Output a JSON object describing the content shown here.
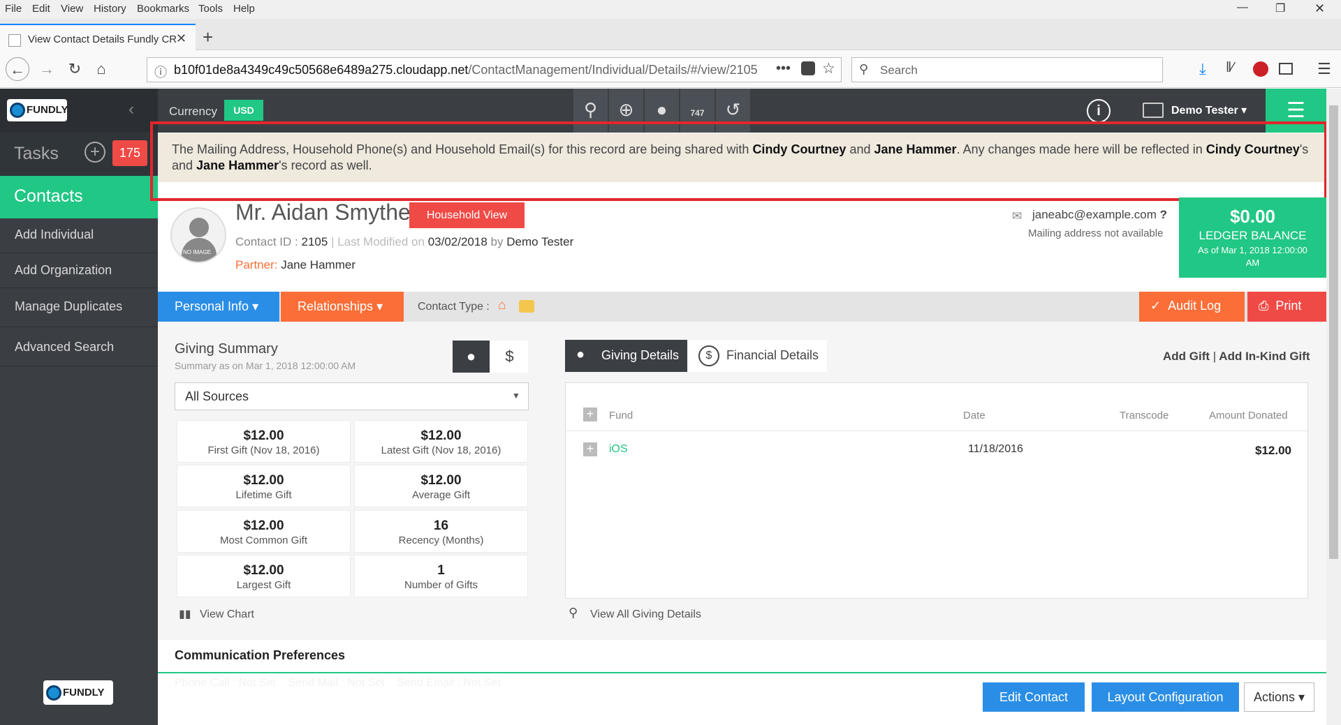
{
  "menubar": {
    "items": [
      "File",
      "Edit",
      "View",
      "History",
      "Bookmarks",
      "Tools",
      "Help"
    ]
  },
  "browser": {
    "tab_title": "View Contact Details Fundly CR",
    "url_domain": "b10f01de8a4349c49c50568e6489a275.cloudapp.net",
    "url_path": "/ContactManagement/Individual/Details/#/view/2105",
    "search_placeholder": "Search"
  },
  "sidebar": {
    "logo": "FUNDLY",
    "tasks_label": "Tasks",
    "tasks_count": "175",
    "contacts_label": "Contacts",
    "items": [
      "Add Individual",
      "Add Organization",
      "Manage Duplicates",
      "Advanced Search"
    ],
    "footer_logo": "FUNDLY"
  },
  "topbar": {
    "currency_label": "Currency",
    "currency_value": "USD",
    "user_name": "Demo Tester",
    "icon_badge": "747"
  },
  "banner": {
    "text1": "The Mailing Address, Household Phone(s) and Household Email(s) for this record are being shared with ",
    "name1": "Cindy Courtney",
    "and": " and ",
    "name2": "Jane Hammer",
    "text2": ". Any changes made here will be reflected in ",
    "name3": "Cindy Courtney",
    "text3": "'s and ",
    "name4": "Jane Hammer",
    "text4": "'s record as well."
  },
  "contact": {
    "name": "Mr. Aidan Smythe",
    "household_button": "Household View",
    "avatar_text": "NO IMAGE",
    "contact_id_label": "Contact ID :",
    "contact_id": "2105",
    "last_modified_label": "| Last Modified on",
    "last_modified_date": "03/02/2018",
    "by_label": "by",
    "modified_by": "Demo Tester",
    "partner_label": "Partner:",
    "partner_name": "Jane Hammer",
    "email": "janeabc@example.com",
    "email_q": "?",
    "mailing_address": "Mailing address not available"
  },
  "ledger": {
    "amount": "$0.00",
    "label": "LEDGER BALANCE",
    "as_of": "As of Mar 1, 2018 12:00:00 AM"
  },
  "tabs": {
    "personal_info": "Personal Info",
    "relationships": "Relationships",
    "contact_type_label": "Contact Type :",
    "audit_log": "Audit Log",
    "print": "Print"
  },
  "giving_summary": {
    "title": "Giving Summary",
    "subtitle": "Summary as on Mar 1, 2018 12:00:00 AM",
    "source_select": "All Sources",
    "cells": [
      {
        "value": "$12.00",
        "label": "First Gift (Nov 18, 2016)"
      },
      {
        "value": "$12.00",
        "label": "Latest Gift (Nov 18, 2016)"
      },
      {
        "value": "$12.00",
        "label": "Lifetime Gift"
      },
      {
        "value": "$12.00",
        "label": "Average Gift"
      },
      {
        "value": "$12.00",
        "label": "Most Common Gift"
      },
      {
        "value": "16",
        "label": "Recency (Months)"
      },
      {
        "value": "$12.00",
        "label": "Largest Gift"
      },
      {
        "value": "1",
        "label": "Number of Gifts"
      }
    ],
    "view_chart": "View Chart"
  },
  "giving_details": {
    "tab_giving": "Giving Details",
    "tab_financial": "Financial Details",
    "add_gift": "Add Gift",
    "separator": "|",
    "add_inkind": "Add In-Kind Gift",
    "columns": [
      "Fund",
      "Date",
      "Transcode",
      "Amount Donated"
    ],
    "rows": [
      {
        "fund": "iOS",
        "date": "11/18/2016",
        "transcode": "",
        "amount": "$12.00"
      }
    ],
    "view_all": "View All Giving Details"
  },
  "comm_prefs": {
    "title": "Communication Preferences",
    "faded_line": "Phone Call : Not Set    Send Mail : Not Set    Send Email : Not Set"
  },
  "footer_buttons": {
    "edit": "Edit Contact",
    "layout": "Layout Configuration",
    "actions": "Actions"
  },
  "colors": {
    "green": "#21c784",
    "red": "#f04a46",
    "orange": "#fb6e37",
    "blue": "#2b8ee6",
    "dark": "#3b3f44",
    "banner_border": "#e2262c"
  }
}
